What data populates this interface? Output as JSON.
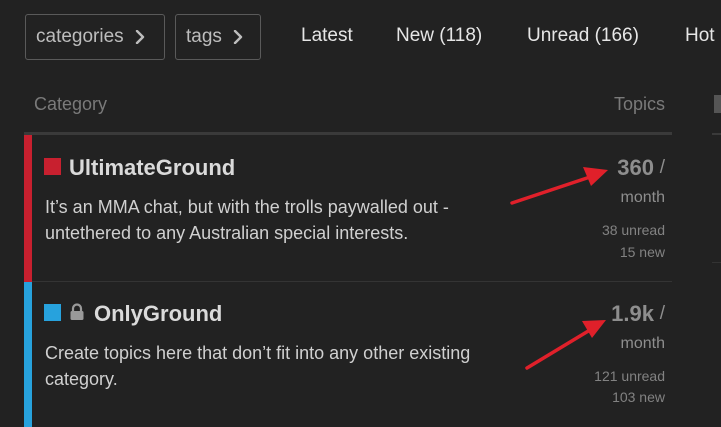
{
  "nav": {
    "categories_label": "categories",
    "tags_label": "tags",
    "tabs": [
      {
        "label": "Latest"
      },
      {
        "label": "New (118)"
      },
      {
        "label": "Unread (166)"
      },
      {
        "label": "Hot"
      }
    ]
  },
  "table": {
    "header_category": "Category",
    "header_topics": "Topics"
  },
  "categories": [
    {
      "name": "UltimateGround",
      "description_line1": "It’s an MMA chat, but with the trolls paywalled out -",
      "description_line2": "untethered to any Australian special interests.",
      "topics": "360",
      "slash": "/",
      "period": "month",
      "unread": "38 unread",
      "new": "15 new",
      "color": "#c8202f",
      "locked": false
    },
    {
      "name": "OnlyGround",
      "description_line1": "Create topics here that don’t fit into any other existing",
      "description_line2": "category.",
      "topics": "1.9k",
      "slash": "/",
      "period": "month",
      "unread": "121 unread",
      "new": "103 new",
      "color": "#27a2dd",
      "locked": true
    }
  ],
  "colors": {
    "background": "#222222",
    "annotation_arrow": "#e0202a"
  }
}
